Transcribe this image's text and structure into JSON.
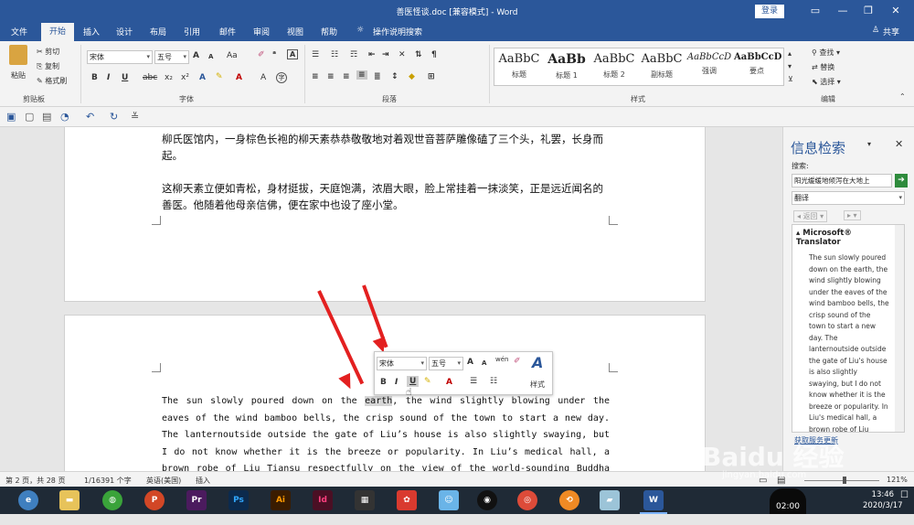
{
  "titlebar": {
    "title": "善医怪谈.doc [兼容模式] - Word",
    "login": "登录"
  },
  "tabs": [
    {
      "label": "文件"
    },
    {
      "label": "开始"
    },
    {
      "label": "插入"
    },
    {
      "label": "设计"
    },
    {
      "label": "布局"
    },
    {
      "label": "引用"
    },
    {
      "label": "邮件"
    },
    {
      "label": "审阅"
    },
    {
      "label": "视图"
    },
    {
      "label": "帮助"
    },
    {
      "label": "操作说明搜索"
    }
  ],
  "share": "共享",
  "clipboard": {
    "paste": "粘贴",
    "cut": "剪切",
    "copy": "复制",
    "format_painter": "格式刷",
    "group": "剪贴板"
  },
  "font": {
    "name": "宋体",
    "size": "五号",
    "group": "字体",
    "grow": "A",
    "shrink": "A",
    "case": "Aa"
  },
  "paragraph": {
    "group": "段落"
  },
  "styles": {
    "group": "样式",
    "items": [
      {
        "sample": "AaBbC",
        "name": "标题"
      },
      {
        "sample": "AaBb",
        "name": "标题 1"
      },
      {
        "sample": "AaBbC",
        "name": "标题 2"
      },
      {
        "sample": "AaBbC",
        "name": "副标题"
      },
      {
        "sample": "AaBbCcD",
        "name": "强调"
      },
      {
        "sample": "AaBbCcD",
        "name": "要点"
      }
    ]
  },
  "editing": {
    "group": "编辑",
    "find": "查找",
    "replace": "替换",
    "select": "选择"
  },
  "doc": {
    "p1": "柳氏医馆内，一身棕色长袍的柳天素恭恭敬敬地对着观世音菩萨雕像磕了三个头，礼罢，长身而起。",
    "p2": "这柳天素立便如青松，身材挺拔，天庭饱满，浓眉大眼，脸上常挂着一抹淡笑，正是远近闻名的善医。他随着他母亲信佛，便在家中也设了座小堂。",
    "e1": "The sun slowly poured down on the",
    "e_sel": "earth",
    "e2": ", the wind slightly blowing under the eaves of the wind bamboo bells, the crisp sound of the town to start a new day.  The lanternoutside outside the gate of Liu’s house is also slightly swaying, but I do not know whether it is the breeze or popularity.  In Liu’s medical hall, a brown robe of Liu Tiansu respectfully on the view of the world-sounding Buddha statue three"
  },
  "minitoolbar": {
    "font": "宋体",
    "size": "五号",
    "styles": "样式",
    "bold": "B",
    "italic": "I",
    "underline": "U"
  },
  "research_pane": {
    "title": "信息检索",
    "search_label": "搜索:",
    "search_value": "阳光缓缓地倾泻在大地上",
    "service": "翻译",
    "back": "返回",
    "section": "Microsoft® Translator",
    "translation": "The sun slowly poured down on the earth, the wind slightly blowing under the eaves of the wind bamboo bells, the crisp sound of the town to start a new day. The lanternoutside outside the gate of Liu's house is also slightly swaying, but I do not know whether it is the breeze or popularity. In Liu's medical hall, a brown robe of Liu Tiansu respectfully on the view",
    "footer": "获取服务更新"
  },
  "status": {
    "page": "第 2 页，共 28 页",
    "words": "1/16391 个字",
    "lang": "英语(美国)",
    "mode": "插入",
    "zoom": "121%"
  },
  "taskbar": {
    "time": "13:46",
    "date": "2020/3/17",
    "clock": "02:00",
    "watermark": "Baidu 经验",
    "watermark_url": "jingyan.baidu.com"
  },
  "colors": {
    "accent": "#2b579a",
    "arrow": "#e32020",
    "selection": "#d6d6d6"
  }
}
